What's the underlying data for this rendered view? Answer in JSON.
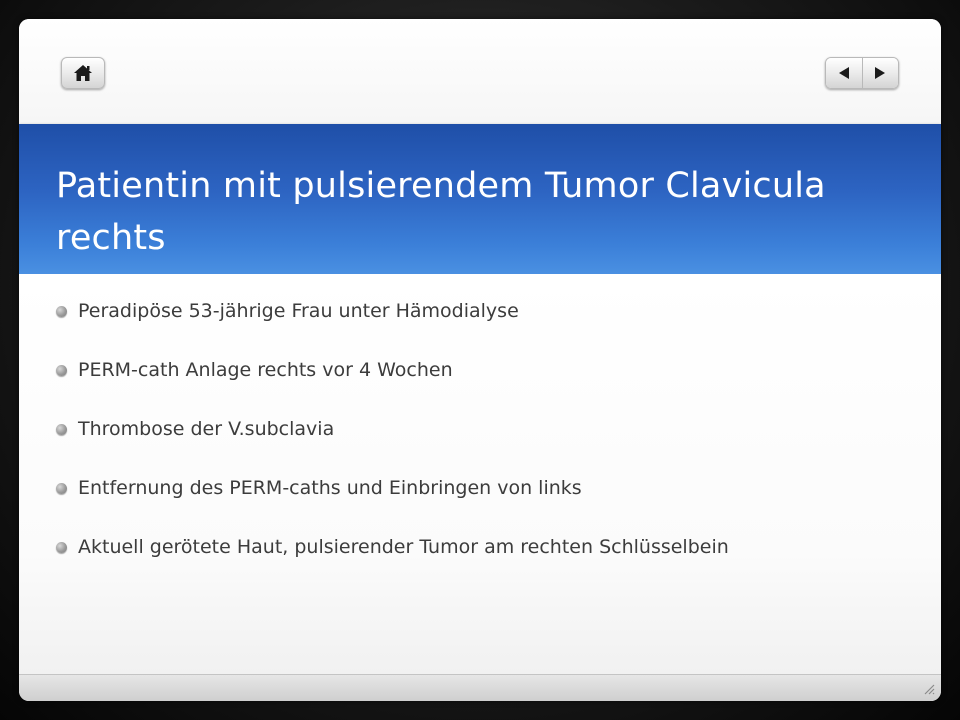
{
  "toolbar": {
    "home_icon": "home-icon",
    "prev_icon": "triangle-left-icon",
    "next_icon": "triangle-right-icon"
  },
  "slide": {
    "title": "Patientin mit pulsierendem Tumor Clavicula rechts",
    "bullets": [
      "Peradipöse 53-jährige Frau unter Hämodialyse",
      "PERM-cath Anlage rechts vor 4 Wochen",
      "Thrombose der V.subclavia",
      "Entfernung des PERM-caths und Einbringen von links",
      "Aktuell gerötete Haut, pulsierender Tumor am rechten Schlüsselbein"
    ]
  },
  "colors": {
    "title_band": "#2d64c2",
    "title_text": "#ffffff",
    "body_text": "#3c3c3c",
    "bullet": "#9a9a9a"
  }
}
